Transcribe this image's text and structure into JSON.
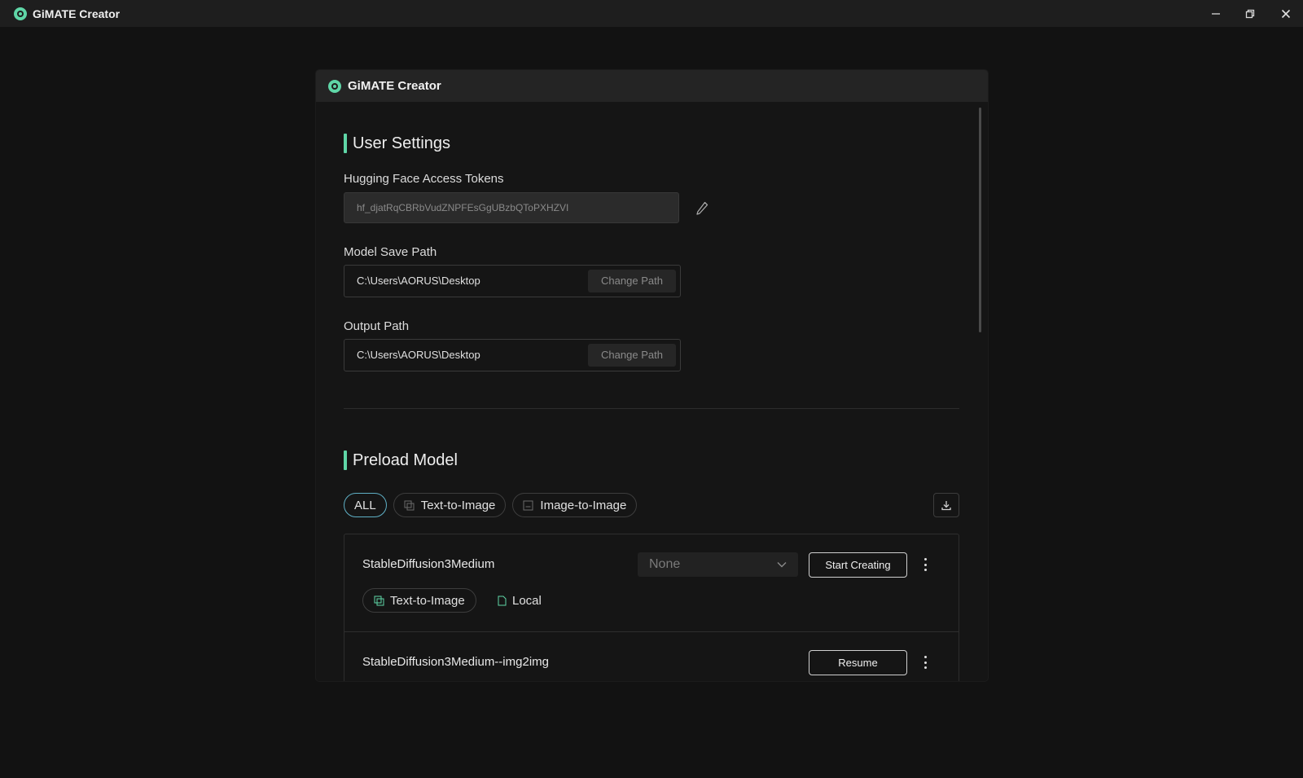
{
  "window": {
    "title": "GiMATE Creator",
    "controls": {
      "minimize": "minimize-icon",
      "restore": "restore-icon",
      "close": "close-icon"
    }
  },
  "panel": {
    "title": "GiMATE Creator"
  },
  "user_settings": {
    "title": "User Settings",
    "token_label": "Hugging Face Access Tokens",
    "token_value": "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",
    "model_save_path_label": "Model Save Path",
    "model_save_path": "C:\\Users\\AORUS\\Desktop",
    "output_path_label": "Output Path",
    "output_path": "C:\\Users\\AORUS\\Desktop",
    "change_path_label": "Change Path"
  },
  "preload_model": {
    "title": "Preload Model",
    "filters": [
      {
        "label": "ALL",
        "active": true
      },
      {
        "label": "Text-to-Image",
        "active": false
      },
      {
        "label": "Image-to-Image",
        "active": false
      }
    ],
    "models": [
      {
        "name": "StableDiffusion3Medium",
        "select_value": "None",
        "action_label": "Start Creating",
        "type_tag": "Text-to-Image",
        "location_tag": "Local"
      },
      {
        "name": "StableDiffusion3Medium--img2img",
        "action_label": "Resume"
      }
    ]
  },
  "colors": {
    "accent": "#5fd6a7",
    "active_chip_border": "#5fb0c6",
    "background": "#121212",
    "titlebar": "#1e1e1e"
  }
}
